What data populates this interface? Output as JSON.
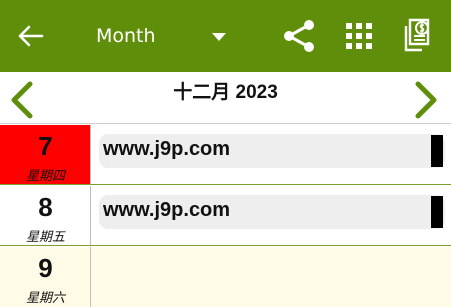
{
  "toolbar": {
    "view_selector_label": "Month",
    "background": "#5f8f0a",
    "icons": [
      "back-arrow-icon",
      "dropdown-caret-icon",
      "share-icon",
      "grid-icon",
      "money-document-icon"
    ]
  },
  "calendar": {
    "month_title": "十二月 2023",
    "nav_color": "#5f8f0a",
    "days": [
      {
        "day": "7",
        "weekday": "星期四",
        "highlight_color": "#ff0000",
        "events": [
          {
            "title": "www.j9p.com",
            "color": "#000000"
          }
        ]
      },
      {
        "day": "8",
        "weekday": "星期五",
        "highlight_color": "#ffffff",
        "events": [
          {
            "title": "www.j9p.com",
            "color": "#000000"
          }
        ]
      },
      {
        "day": "9",
        "weekday": "星期六",
        "highlight_color": "#fffbe6",
        "events": []
      }
    ]
  }
}
